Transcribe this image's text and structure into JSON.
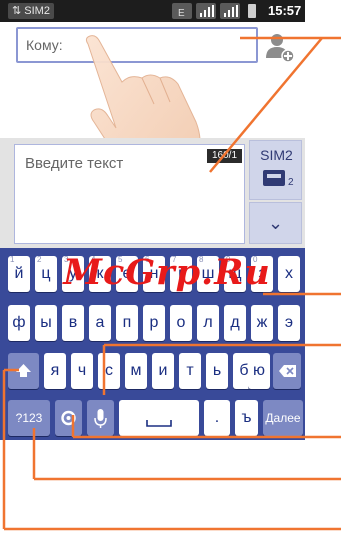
{
  "status_bar": {
    "sim_tag": "SIM2",
    "network_icon": "e-network-icon",
    "time": "15:57"
  },
  "compose": {
    "to_label": "Кому:",
    "message_placeholder": "Введите текст",
    "char_counter": "160/1",
    "send_sim_label": "SIM2",
    "send_sim_number": "2",
    "expand_icon": "chevron-down-icon"
  },
  "keyboard": {
    "row1": [
      "й",
      "ц",
      "у",
      "к",
      "е",
      "н",
      "г",
      "ш",
      "щ",
      "з",
      "х"
    ],
    "row1_hints": [
      "1",
      "2",
      "3",
      "4",
      "5",
      "6",
      "7",
      "8",
      "9",
      "0",
      ""
    ],
    "row2": [
      "ф",
      "ы",
      "в",
      "а",
      "п",
      "р",
      "о",
      "л",
      "д",
      "ж",
      "э"
    ],
    "row3": [
      "я",
      "ч",
      "с",
      "м",
      "и",
      "т",
      "ь",
      "б",
      "ю"
    ],
    "symbols_key": "?123",
    "period_key": ".",
    "hard_sign_key": "ъ",
    "next_key": "Далее"
  },
  "watermark": "McGrp.Ru",
  "colors": {
    "keyboard_bg": "#394a99",
    "callout": "#f07430"
  }
}
